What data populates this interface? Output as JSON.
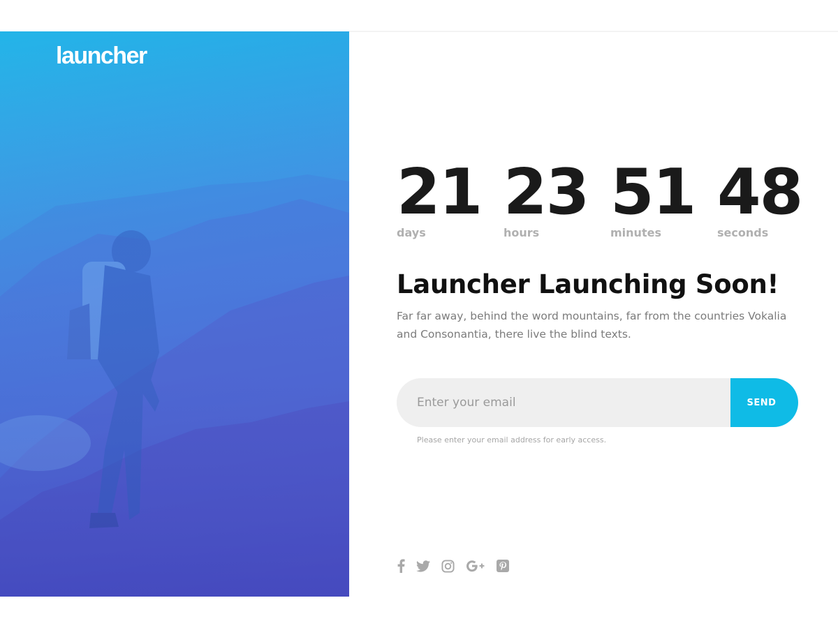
{
  "brand": {
    "logo_text": "launcher"
  },
  "countdown": [
    {
      "value": "21",
      "label": "days"
    },
    {
      "value": "23",
      "label": "hours"
    },
    {
      "value": "51",
      "label": "minutes"
    },
    {
      "value": "48",
      "label": "seconds"
    }
  ],
  "hero": {
    "headline": "Launcher Launching Soon!",
    "description": "Far far away, behind the word mountains, far from the countries Vokalia and Consonantia, there live the blind texts."
  },
  "subscribe": {
    "placeholder": "Enter your email",
    "button_label": "SEND",
    "hint": "Please enter your email address for early access."
  },
  "social": [
    {
      "icon": "facebook-icon"
    },
    {
      "icon": "twitter-icon"
    },
    {
      "icon": "instagram-icon"
    },
    {
      "icon": "google-plus-icon"
    },
    {
      "icon": "pinterest-icon"
    }
  ],
  "colors": {
    "accent": "#0fbbe6",
    "gradient_top": "#23b5e8",
    "gradient_bottom": "#5b49d6",
    "heading": "#111111",
    "muted": "#b0b0b0"
  }
}
